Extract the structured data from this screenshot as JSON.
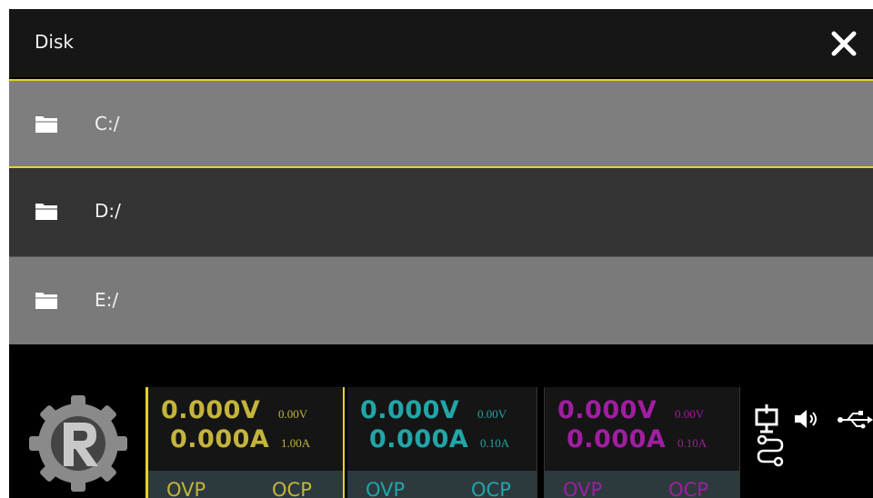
{
  "window": {
    "title": "Disk"
  },
  "disks": [
    {
      "label": "C:/",
      "icon": "folder-icon",
      "selected": true
    },
    {
      "label": "D:/",
      "icon": "folder-icon",
      "selected": false
    },
    {
      "label": "E:/",
      "icon": "folder-icon",
      "selected": false
    }
  ],
  "channels": [
    {
      "voltage": "0.000V",
      "current": "0.000A",
      "set_voltage": "0.00V",
      "set_current": "1.00A",
      "ovp": "OVP",
      "ocp": "OCP",
      "color": "#c4b43a"
    },
    {
      "voltage": "0.000V",
      "current": "0.000A",
      "set_voltage": "0.00V",
      "set_current": "0.10A",
      "ovp": "OVP",
      "ocp": "OCP",
      "color": "#22a5a8"
    },
    {
      "voltage": "0.000V",
      "current": "0.000A",
      "set_voltage": "0.00V",
      "set_current": "0.10A",
      "ovp": "OVP",
      "ocp": "OCP",
      "color": "#a01ea0"
    }
  ],
  "status_icons": [
    "network-icon",
    "speaker-icon",
    "usb-icon",
    "sequence-icon"
  ],
  "colors": {
    "selection_border": "#e6d22a",
    "selected_row": "#7e7e7e",
    "row_dark": "#343434"
  }
}
